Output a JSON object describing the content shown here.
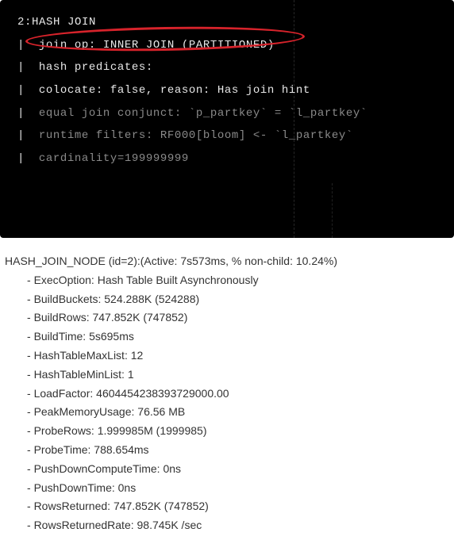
{
  "terminal": {
    "header": "2:HASH JOIN",
    "lines": [
      "join op: INNER JOIN (PARTITIONED)",
      "hash predicates:",
      "colocate: false, reason: Has join hint",
      "equal join conjunct: `p_partkey` = `l_partkey`",
      "runtime filters: RF000[bloom] <- `l_partkey`",
      "cardinality=199999999"
    ]
  },
  "annotation": {
    "color": "#d7232b"
  },
  "stats": {
    "header": "HASH_JOIN_NODE (id=2):(Active: 7s573ms, % non-child: 10.24%)",
    "rows": [
      "ExecOption: Hash Table Built Asynchronously",
      "BuildBuckets: 524.288K (524288)",
      "BuildRows: 747.852K (747852)",
      "BuildTime: 5s695ms",
      "HashTableMaxList: 12",
      "HashTableMinList: 1",
      "LoadFactor: 4604454238393729000.00",
      "PeakMemoryUsage: 76.56 MB",
      "ProbeRows: 1.999985M (1999985)",
      "ProbeTime: 788.654ms",
      "PushDownComputeTime: 0ns",
      "PushDownTime: 0ns",
      "RowsReturned: 747.852K (747852)",
      "RowsReturnedRate: 98.745K /sec"
    ]
  }
}
